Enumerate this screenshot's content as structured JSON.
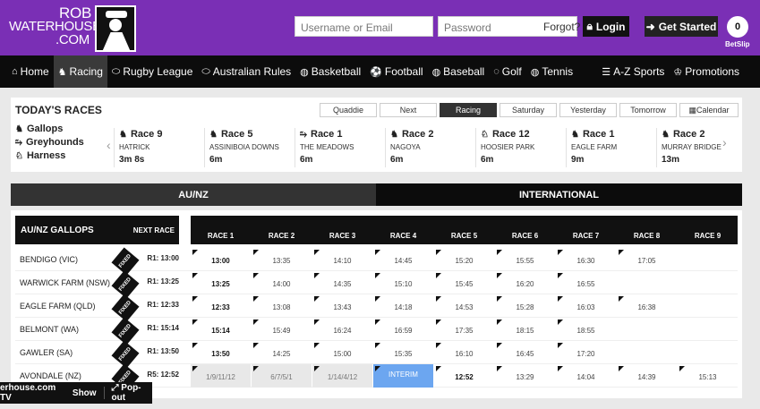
{
  "brand": {
    "line1": "ROB",
    "line2": "WATERHOUSE",
    "line3": ".COM"
  },
  "login": {
    "username_placeholder": "Username or Email",
    "password_placeholder": "Password",
    "forgot": "Forgot?",
    "login_label": "Login",
    "get_started_label": "Get Started",
    "betslip_count": "0",
    "betslip_label": "BetSlip"
  },
  "nav": [
    {
      "label": "Home",
      "icon": "home-icon",
      "glyph": "⌂"
    },
    {
      "label": "Racing",
      "icon": "horse-icon",
      "glyph": "♞",
      "active": true
    },
    {
      "label": "Rugby League",
      "icon": "rugby-ball-icon",
      "glyph": "⬭"
    },
    {
      "label": "Australian Rules",
      "icon": "football-icon",
      "glyph": "⬭"
    },
    {
      "label": "Basketball",
      "icon": "basketball-icon",
      "glyph": "◍"
    },
    {
      "label": "Football",
      "icon": "soccer-ball-icon",
      "glyph": "⚽"
    },
    {
      "label": "Baseball",
      "icon": "baseball-icon",
      "glyph": "◍"
    },
    {
      "label": "Golf",
      "icon": "golf-icon",
      "glyph": "◌"
    },
    {
      "label": "Tennis",
      "icon": "tennis-icon",
      "glyph": "◍"
    }
  ],
  "nav_right": [
    {
      "label": "A-Z Sports",
      "icon": "list-icon",
      "glyph": "☰"
    },
    {
      "label": "Promotions",
      "icon": "trophy-icon",
      "glyph": "♔"
    }
  ],
  "todays": {
    "title": "TODAY'S RACES",
    "filters": [
      {
        "label": "Gallops",
        "icon": "horse-icon"
      },
      {
        "label": "Greyhounds",
        "icon": "greyhound-icon"
      },
      {
        "label": "Harness",
        "icon": "harness-icon"
      }
    ],
    "tabs": [
      "Quaddie",
      "Next",
      "Racing",
      "Saturday",
      "Yesterday",
      "Tomorrow",
      "Calendar"
    ],
    "active_tab": "Racing",
    "next_races": [
      {
        "race": "Race 9",
        "venue": "HATRICK",
        "time": "3m 8s",
        "icon": "horse-icon"
      },
      {
        "race": "Race 5",
        "venue": "ASSINIBOIA DOWNS",
        "time": "6m",
        "icon": "horse-icon"
      },
      {
        "race": "Race 1",
        "venue": "THE MEADOWS",
        "time": "6m",
        "icon": "greyhound-icon"
      },
      {
        "race": "Race 2",
        "venue": "NAGOYA",
        "time": "6m",
        "icon": "horse-icon"
      },
      {
        "race": "Race 12",
        "venue": "HOOSIER PARK",
        "time": "6m",
        "icon": "harness-icon"
      },
      {
        "race": "Race 1",
        "venue": "EAGLE FARM",
        "time": "9m",
        "icon": "horse-icon"
      },
      {
        "race": "Race 2",
        "venue": "MURRAY BRIDGE",
        "time": "13m",
        "icon": "horse-icon"
      }
    ]
  },
  "regions": {
    "aunz": "AU/NZ",
    "intl": "INTERNATIONAL"
  },
  "grid": {
    "title": "AU/NZ GALLOPS",
    "next_header": "NEXT RACE",
    "fixed_label": "FIXED",
    "columns": [
      "RACE 1",
      "RACE 2",
      "RACE 3",
      "RACE 4",
      "RACE 5",
      "RACE 6",
      "RACE 7",
      "RACE 8",
      "RACE 9"
    ],
    "rows": [
      {
        "name": "BENDIGO (VIC)",
        "next": "R1: 13:00",
        "cells": [
          "13:00",
          "13:35",
          "14:10",
          "14:45",
          "15:20",
          "15:55",
          "16:30",
          "17:05",
          ""
        ],
        "bold": [
          0
        ],
        "past": []
      },
      {
        "name": "WARWICK FARM (NSW)",
        "next": "R1: 13:25",
        "cells": [
          "13:25",
          "14:00",
          "14:35",
          "15:10",
          "15:45",
          "16:20",
          "16:55",
          "",
          ""
        ],
        "bold": [
          0
        ],
        "past": []
      },
      {
        "name": "EAGLE FARM (QLD)",
        "next": "R1: 12:33",
        "cells": [
          "12:33",
          "13:08",
          "13:43",
          "14:18",
          "14:53",
          "15:28",
          "16:03",
          "16:38",
          ""
        ],
        "bold": [
          0
        ],
        "past": []
      },
      {
        "name": "BELMONT (WA)",
        "next": "R1: 15:14",
        "cells": [
          "15:14",
          "15:49",
          "16:24",
          "16:59",
          "17:35",
          "18:15",
          "18:55",
          "",
          ""
        ],
        "bold": [
          0
        ],
        "past": []
      },
      {
        "name": "GAWLER (SA)",
        "next": "R1: 13:50",
        "cells": [
          "13:50",
          "14:25",
          "15:00",
          "15:35",
          "16:10",
          "16:45",
          "17:20",
          "",
          ""
        ],
        "bold": [
          0
        ],
        "past": []
      },
      {
        "name": "AVONDALE (NZ)",
        "next": "R5: 12:52",
        "cells": [
          "1/9/11/12",
          "6/7/5/1",
          "1/14/4/12",
          "INTERIM",
          "12:52",
          "13:29",
          "14:04",
          "14:39",
          "15:13"
        ],
        "bold": [
          4
        ],
        "past": [
          0,
          1,
          2
        ],
        "interim": 3
      }
    ]
  },
  "tv": {
    "label": "erhouse.com TV",
    "show": "Show",
    "popout": "Pop-out"
  }
}
